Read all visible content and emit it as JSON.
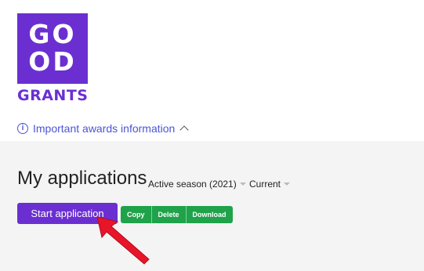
{
  "brand": {
    "logo_line1": "GO",
    "logo_line2": "OD",
    "word": "GRANTS"
  },
  "awards": {
    "label": "Important awards information"
  },
  "main": {
    "title": "My applications",
    "filters": {
      "season": "Active season (2021)",
      "status": "Current"
    },
    "start_button": "Start application",
    "actions": {
      "copy": "Copy",
      "delete": "Delete",
      "download": "Download"
    }
  },
  "colors": {
    "brand_purple": "#6b2fd1",
    "action_green": "#1fa24a",
    "link_blue": "#4b55d6",
    "arrow_red": "#e8152a"
  },
  "icons": {
    "info": "info-icon",
    "chevron": "chevron-up-icon",
    "caret": "caret-down-icon",
    "annotation": "red-arrow-icon"
  }
}
